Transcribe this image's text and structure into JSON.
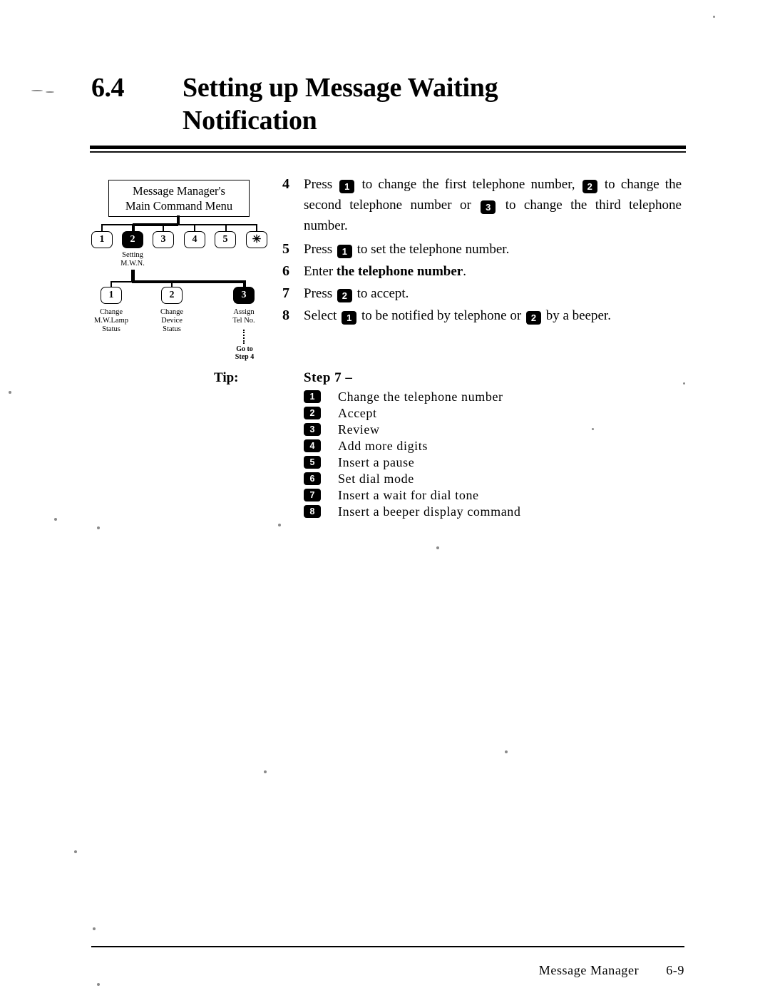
{
  "document": {
    "section_number": "6.4",
    "section_title": "Setting up Message Waiting Notification",
    "title_line1": "Setting up Message Waiting",
    "title_line2": "Notification"
  },
  "flowchart": {
    "root_box": {
      "line1": "Message Manager's",
      "line2": "Main Command Menu"
    },
    "level1_keys": [
      {
        "key": "1",
        "selected": false,
        "label": ""
      },
      {
        "key": "2",
        "selected": true,
        "label_line1": "Setting",
        "label_line2": "M.W.N."
      },
      {
        "key": "3",
        "selected": false,
        "label": ""
      },
      {
        "key": "4",
        "selected": false,
        "label": ""
      },
      {
        "key": "5",
        "selected": false,
        "label": ""
      },
      {
        "key": "✳",
        "selected": false,
        "label": ""
      }
    ],
    "level2_keys": [
      {
        "key": "1",
        "selected": false,
        "label_line1": "Change",
        "label_line2": "M.W.Lamp",
        "label_line3": "Status"
      },
      {
        "key": "2",
        "selected": false,
        "label_line1": "Change",
        "label_line2": "Device",
        "label_line3": "Status"
      },
      {
        "key": "3",
        "selected": true,
        "label_line1": "Assign",
        "label_line2": "Tel No.",
        "label_line3": ""
      }
    ],
    "goto_note_line1": "Go to",
    "goto_note_line2": "Step 4"
  },
  "steps": [
    {
      "number": "4",
      "parts": [
        {
          "t": "text",
          "v": "Press "
        },
        {
          "t": "key",
          "v": "1"
        },
        {
          "t": "text",
          "v": " to change the first telephone number, "
        },
        {
          "t": "key",
          "v": "2"
        },
        {
          "t": "text",
          "v": " to change the second telephone number or "
        },
        {
          "t": "key",
          "v": "3"
        },
        {
          "t": "text",
          "v": " to change the third telephone number."
        }
      ]
    },
    {
      "number": "5",
      "parts": [
        {
          "t": "text",
          "v": "Press "
        },
        {
          "t": "key",
          "v": "1"
        },
        {
          "t": "text",
          "v": " to set the telephone number."
        }
      ]
    },
    {
      "number": "6",
      "parts": [
        {
          "t": "text",
          "v": "Enter "
        },
        {
          "t": "bold",
          "v": "the telephone number"
        },
        {
          "t": "text",
          "v": "."
        }
      ]
    },
    {
      "number": "7",
      "parts": [
        {
          "t": "text",
          "v": "Press "
        },
        {
          "t": "key",
          "v": "2"
        },
        {
          "t": "text",
          "v": " to accept."
        }
      ]
    },
    {
      "number": "8",
      "parts": [
        {
          "t": "text",
          "v": "Select "
        },
        {
          "t": "key",
          "v": "1"
        },
        {
          "t": "text",
          "v": " to be notified by telephone or "
        },
        {
          "t": "key",
          "v": "2"
        },
        {
          "t": "text",
          "v": " by a beeper."
        }
      ]
    }
  ],
  "tip": {
    "label": "Tip:",
    "heading": "Step 7 –",
    "items": [
      {
        "key": "1",
        "text": "Change the telephone number"
      },
      {
        "key": "2",
        "text": "Accept"
      },
      {
        "key": "3",
        "text": "Review"
      },
      {
        "key": "4",
        "text": "Add more digits"
      },
      {
        "key": "5",
        "text": "Insert a pause"
      },
      {
        "key": "6",
        "text": "Set dial mode"
      },
      {
        "key": "7",
        "text": "Insert a wait for dial tone"
      },
      {
        "key": "8",
        "text": "Insert a beeper display command"
      }
    ]
  },
  "footer": {
    "name": "Message Manager",
    "page": "6-9"
  }
}
